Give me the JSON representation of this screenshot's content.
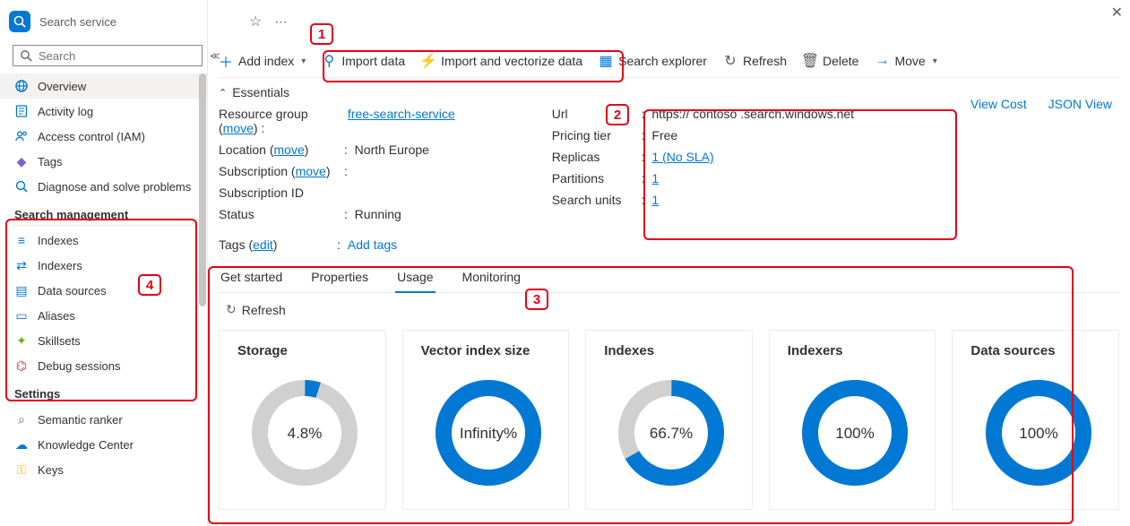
{
  "sidebar": {
    "service_label": "Search service",
    "search_placeholder": "Search",
    "items_top": [
      {
        "label": "Overview",
        "icon": "globe-icon"
      },
      {
        "label": "Activity log",
        "icon": "log-icon"
      },
      {
        "label": "Access control (IAM)",
        "icon": "people-icon"
      },
      {
        "label": "Tags",
        "icon": "tag-icon"
      },
      {
        "label": "Diagnose and solve problems",
        "icon": "diagnose-icon"
      }
    ],
    "section_mgmt": "Search management",
    "items_mgmt": [
      {
        "label": "Indexes",
        "icon": "indexes-icon"
      },
      {
        "label": "Indexers",
        "icon": "indexers-icon"
      },
      {
        "label": "Data sources",
        "icon": "database-icon"
      },
      {
        "label": "Aliases",
        "icon": "alias-icon"
      },
      {
        "label": "Skillsets",
        "icon": "skillset-icon"
      },
      {
        "label": "Debug sessions",
        "icon": "bug-icon"
      }
    ],
    "section_settings": "Settings",
    "items_settings": [
      {
        "label": "Semantic ranker",
        "icon": "semantic-icon"
      },
      {
        "label": "Knowledge Center",
        "icon": "knowledge-icon"
      },
      {
        "label": "Keys",
        "icon": "key-icon"
      }
    ]
  },
  "toolbar": {
    "add_index": "Add index",
    "import_data": "Import data",
    "import_vectorize": "Import and vectorize data",
    "search_explorer": "Search explorer",
    "refresh": "Refresh",
    "delete": "Delete",
    "move": "Move"
  },
  "header_links": {
    "view_cost": "View Cost",
    "json_view": "JSON View"
  },
  "essentials": {
    "heading": "Essentials",
    "left": {
      "resource_group_label": "Resource group",
      "resource_group_move": "move",
      "resource_group_value": "free-search-service",
      "location_label": "Location",
      "location_move": "move",
      "location_value": "North Europe",
      "subscription_label": "Subscription",
      "subscription_move": "move",
      "subscription_value": "",
      "subscription_id_label": "Subscription ID",
      "subscription_id_value": "",
      "status_label": "Status",
      "status_value": "Running"
    },
    "right": {
      "url_label": "Url",
      "url_value": "https:// contoso .search.windows.net",
      "tier_label": "Pricing tier",
      "tier_value": "Free",
      "replicas_label": "Replicas",
      "replicas_value": "1 (No SLA)",
      "partitions_label": "Partitions",
      "partitions_value": "1",
      "search_units_label": "Search units",
      "search_units_value": "1"
    },
    "tags_label": "Tags",
    "tags_edit": "edit",
    "tags_add": "Add tags"
  },
  "tabs": {
    "get_started": "Get started",
    "properties": "Properties",
    "usage": "Usage",
    "monitoring": "Monitoring"
  },
  "usage": {
    "refresh": "Refresh",
    "cards": [
      {
        "title": "Storage",
        "pct": 4.8,
        "display": "4.8%"
      },
      {
        "title": "Vector index size",
        "pct": 100,
        "display": "Infinity%"
      },
      {
        "title": "Indexes",
        "pct": 66.7,
        "display": "66.7%"
      },
      {
        "title": "Indexers",
        "pct": 100,
        "display": "100%"
      },
      {
        "title": "Data sources",
        "pct": 100,
        "display": "100%"
      }
    ]
  },
  "chart_data": [
    {
      "type": "pie",
      "title": "Storage",
      "values": [
        4.8,
        95.2
      ],
      "display": "4.8%"
    },
    {
      "type": "pie",
      "title": "Vector index size",
      "values": [
        100,
        0
      ],
      "display": "Infinity%"
    },
    {
      "type": "pie",
      "title": "Indexes",
      "values": [
        66.7,
        33.3
      ],
      "display": "66.7%"
    },
    {
      "type": "pie",
      "title": "Indexers",
      "values": [
        100,
        0
      ],
      "display": "100%"
    },
    {
      "type": "pie",
      "title": "Data sources",
      "values": [
        100,
        0
      ],
      "display": "100%"
    }
  ],
  "annotations": {
    "n1": "1",
    "n2": "2",
    "n3": "3",
    "n4": "4"
  }
}
